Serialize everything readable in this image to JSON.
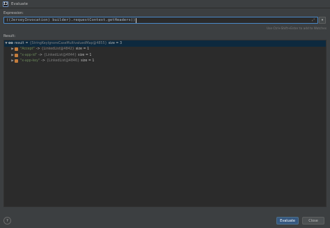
{
  "window": {
    "title": "Evaluate",
    "app_icon_glyph": "IJ"
  },
  "expression": {
    "label": "Expression:",
    "value": "((JerseyInvocation) builder).requestContext.getHeaders()",
    "hint": "Use Ctrl+Shift+Enter to add to Watches"
  },
  "result": {
    "label": "Result:",
    "root": {
      "marker": "oo",
      "name": "result",
      "eq": "=",
      "type": "{StringKeyIgnoreCaseMultivaluedMap@4855}",
      "size": "size = 3"
    },
    "entries": [
      {
        "key": "\"Accept\"",
        "arrow": "->",
        "type": "{LinkedList@4842}",
        "size": "size = 1"
      },
      {
        "key": "\"x-app-id\"",
        "arrow": "->",
        "type": "{LinkedList@4844}",
        "size": "size = 1"
      },
      {
        "key": "\"x-app-key\"",
        "arrow": "->",
        "type": "{LinkedList@4846}",
        "size": "size = 1"
      }
    ]
  },
  "footer": {
    "help_label": "?",
    "evaluate_label": "Evaluate",
    "close_label": "Close"
  },
  "colors": {
    "background": "#3c3f41",
    "editor_bg": "#2b2b2b",
    "selection": "#0d293e",
    "accent": "#365880"
  },
  "icons": {
    "expand": "expand-icon",
    "dropdown": "chevron-down-icon",
    "tree_arrow": "triangle-right-icon",
    "field": "field-icon"
  }
}
